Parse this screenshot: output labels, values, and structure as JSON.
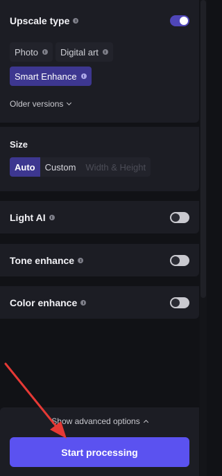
{
  "upscale": {
    "title": "Upscale type",
    "toggle_on": true,
    "options": [
      {
        "label": "Photo",
        "active": false
      },
      {
        "label": "Digital art",
        "active": false
      },
      {
        "label": "Smart Enhance",
        "active": true
      }
    ],
    "older_versions": "Older versions"
  },
  "size": {
    "title": "Size",
    "options": [
      "Auto",
      "Custom",
      "Width & Height"
    ],
    "selected": "Auto"
  },
  "light_ai": {
    "title": "Light AI",
    "toggle_on": false
  },
  "tone_enhance": {
    "title": "Tone enhance",
    "toggle_on": false
  },
  "color_enhance": {
    "title": "Color enhance",
    "toggle_on": false
  },
  "footer": {
    "advanced_options": "Show advanced options",
    "start_button": "Start processing"
  },
  "colors": {
    "accent": "#5b52f0",
    "active_chip": "#3d3790",
    "annotation_arrow": "#e53935"
  }
}
